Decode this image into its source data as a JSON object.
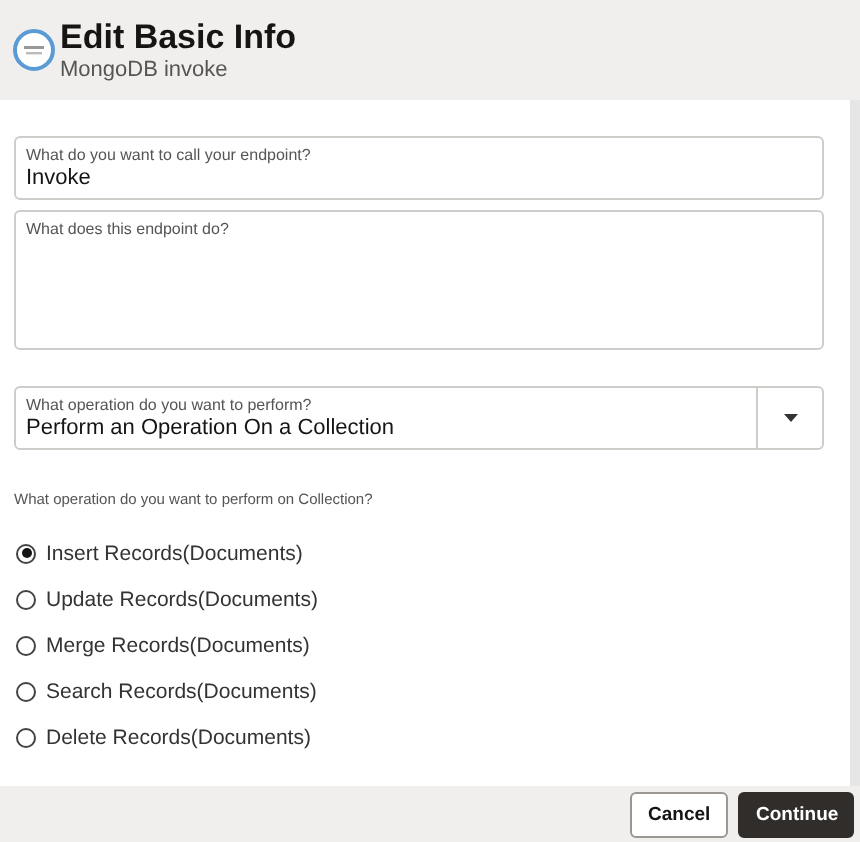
{
  "header": {
    "title": "Edit Basic Info",
    "subtitle": "MongoDB invoke"
  },
  "fields": [
    {
      "kind": "text",
      "label": "What do you want to call your endpoint?",
      "value": "Invoke"
    },
    {
      "kind": "textarea",
      "label": "What does this endpoint do?"
    },
    {
      "kind": "select",
      "label": "What operation do you want to perform?",
      "value": "Perform an Operation On a Collection"
    }
  ],
  "operation_group": {
    "label": "What operation do you want to perform on Collection?",
    "options": [
      {
        "label": "Insert Records(Documents)",
        "selected": true
      },
      {
        "label": "Update Records(Documents)",
        "selected": false
      },
      {
        "label": "Merge Records(Documents)",
        "selected": false
      },
      {
        "label": "Search Records(Documents)",
        "selected": false
      },
      {
        "label": "Delete Records(Documents)",
        "selected": false
      }
    ]
  },
  "buttons": [
    {
      "label": "Cancel",
      "kind": "secondary"
    },
    {
      "label": "Continue",
      "kind": "primary"
    }
  ]
}
